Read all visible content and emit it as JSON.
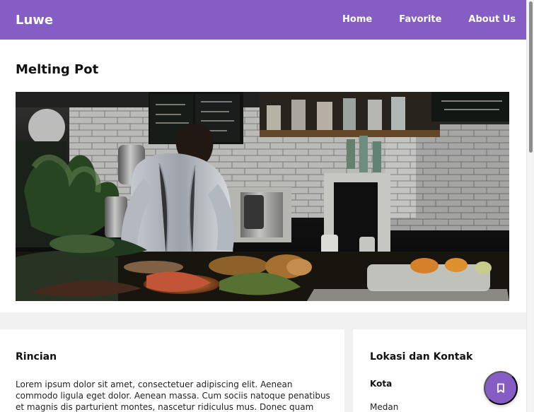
{
  "app": {
    "brand": "Luwe"
  },
  "nav": {
    "items": [
      {
        "label": "Home"
      },
      {
        "label": "Favorite"
      },
      {
        "label": "About Us"
      }
    ]
  },
  "restaurant": {
    "name": "Melting Pot"
  },
  "details": {
    "heading": "Rincian",
    "description": "Lorem ipsum dolor sit amet, consectetuer adipiscing elit. Aenean commodo ligula eget dolor. Aenean massa. Cum sociis natoque penatibus et magnis dis parturient montes, nascetur ridiculus mus. Donec quam felis, ultricies nec,"
  },
  "contact": {
    "heading": "Lokasi dan Kontak",
    "city_label": "Kota",
    "city_value": "Medan"
  },
  "actions": {
    "favorite_icon": "bookmark-icon"
  },
  "colors": {
    "primary": "#865dc5",
    "background": "#f0f0f0",
    "card": "#ffffff"
  }
}
